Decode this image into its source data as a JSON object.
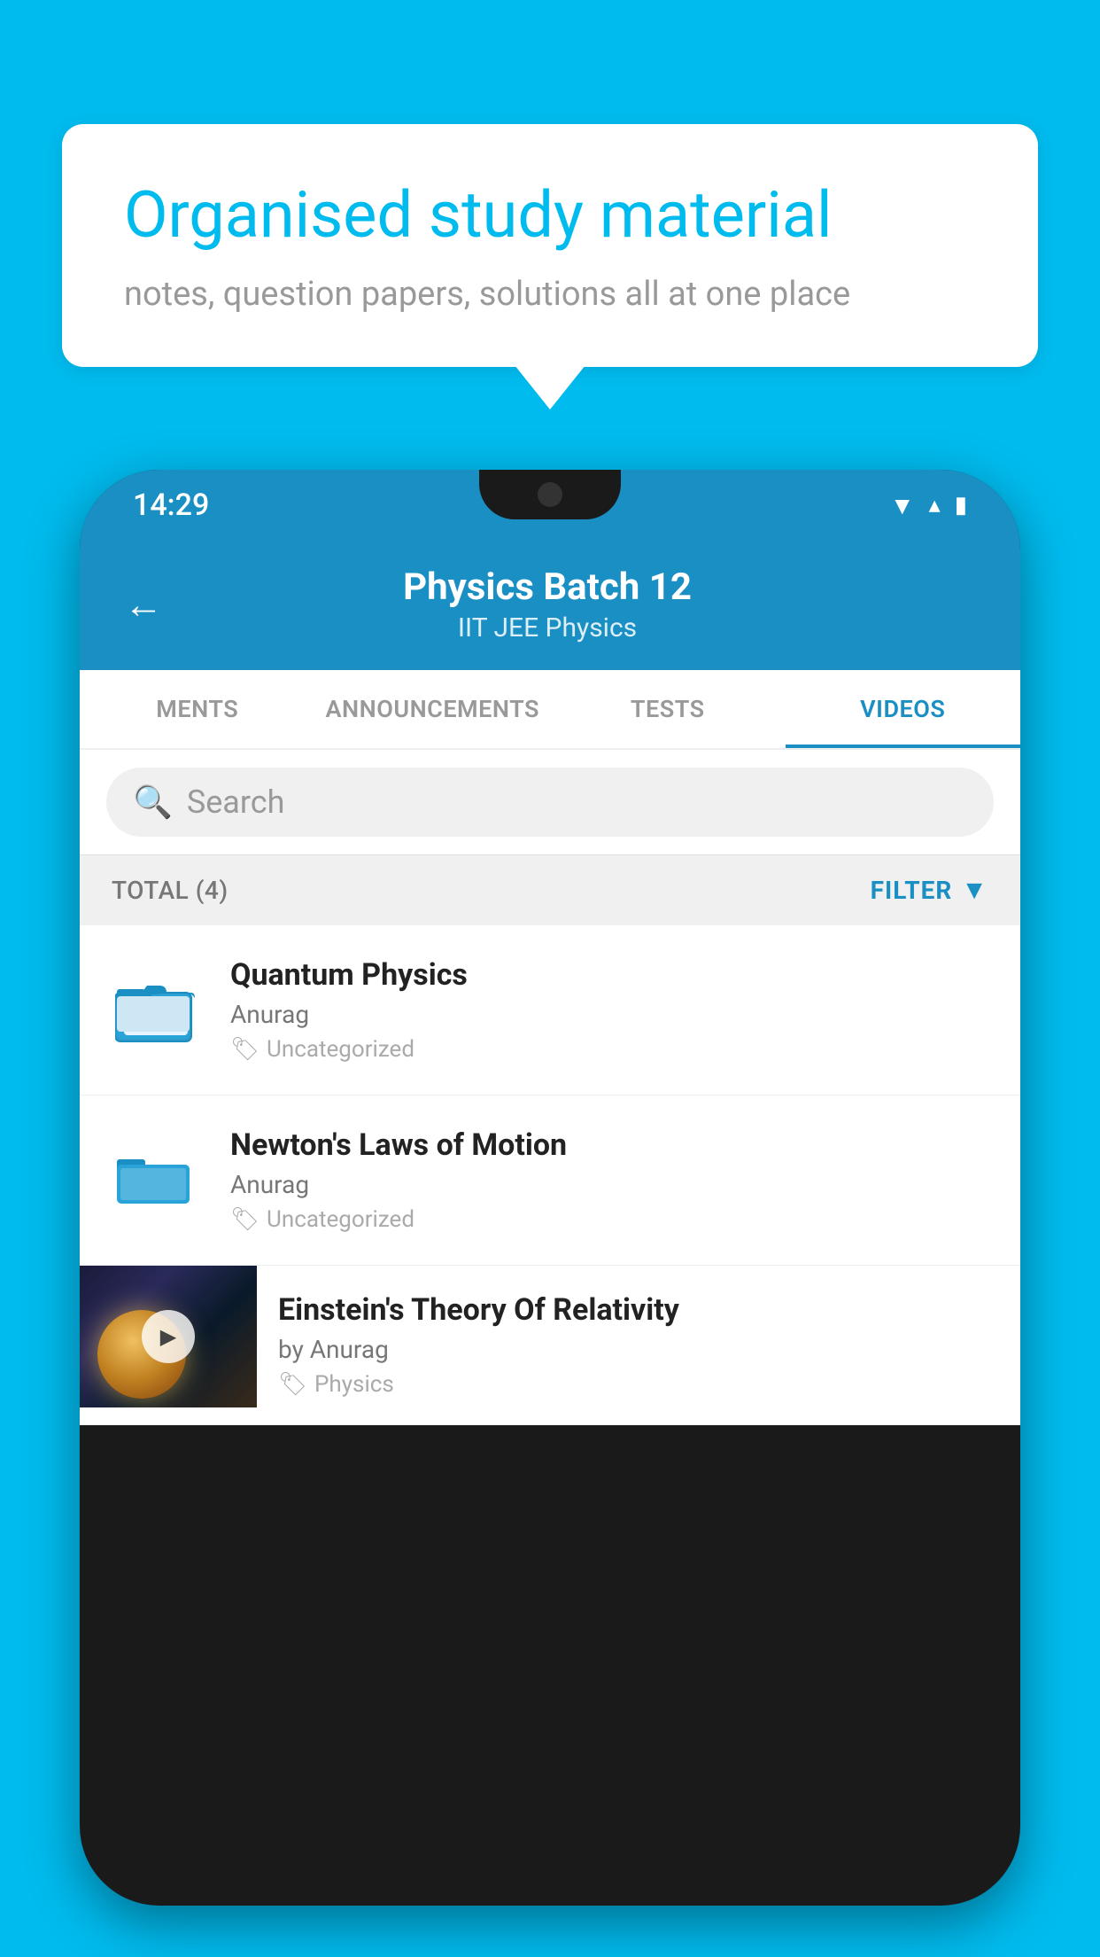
{
  "background_color": "#00BBEE",
  "speech_bubble": {
    "title": "Organised study material",
    "subtitle": "notes, question papers, solutions all at one place"
  },
  "status_bar": {
    "time": "14:29",
    "wifi": "▾",
    "signal": "▲",
    "battery": "▮"
  },
  "app_header": {
    "back_label": "←",
    "title": "Physics Batch 12",
    "subtitle": "IIT JEE   Physics"
  },
  "tabs": [
    {
      "label": "MENTS",
      "active": false
    },
    {
      "label": "ANNOUNCEMENTS",
      "active": false
    },
    {
      "label": "TESTS",
      "active": false
    },
    {
      "label": "VIDEOS",
      "active": true
    }
  ],
  "search": {
    "placeholder": "Search"
  },
  "filter_row": {
    "total_label": "TOTAL (4)",
    "filter_label": "FILTER"
  },
  "videos": [
    {
      "type": "folder",
      "title": "Quantum Physics",
      "author": "Anurag",
      "tag": "Uncategorized"
    },
    {
      "type": "folder",
      "title": "Newton's Laws of Motion",
      "author": "Anurag",
      "tag": "Uncategorized"
    },
    {
      "type": "thumbnail",
      "title": "Einstein's Theory Of Relativity",
      "author": "by Anurag",
      "tag": "Physics"
    }
  ],
  "icons": {
    "search": "🔍",
    "filter": "▼",
    "back": "←",
    "tag": "🏷",
    "play": "▶"
  }
}
